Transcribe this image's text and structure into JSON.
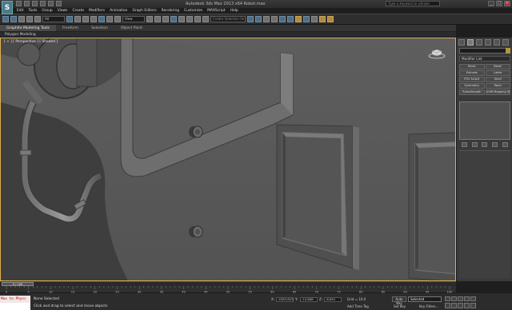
{
  "window": {
    "title": "Autodesk 3ds Max 2013 x64   Robot.max",
    "search_placeholder": "Type a keyword or phrase",
    "app_logo": "S"
  },
  "menu": [
    "Edit",
    "Tools",
    "Group",
    "Views",
    "Create",
    "Modifiers",
    "Animation",
    "Graph Editors",
    "Rendering",
    "Customize",
    "MAXScript",
    "Help"
  ],
  "toolbar": {
    "selection_filter": "All",
    "reference_coord": "View",
    "named_selection": "Create Selection Se"
  },
  "ribbon": {
    "tabs": [
      "Graphite Modeling Tools",
      "Freeform",
      "Selection",
      "Object Paint"
    ],
    "active_tab": "Graphite Modeling Tools",
    "sub_panel": "Polygon Modeling"
  },
  "viewport": {
    "label": "[ + ] [ Perspective ] [ Shaded ]"
  },
  "command_panel": {
    "modifier_list": "Modifier List",
    "buttons": [
      "Bend",
      "Bevel",
      "Extrude",
      "Lathe",
      "FFD 3x3x3",
      "Shell",
      "Symmetry",
      "Taper",
      "TurboSmooth",
      "UVW Mapping XF"
    ]
  },
  "timeline": {
    "frame": "0 / 100",
    "ticks": [
      "0",
      "5",
      "10",
      "15",
      "20",
      "25",
      "30",
      "35",
      "40",
      "45",
      "50",
      "55",
      "60",
      "65",
      "70",
      "75",
      "80",
      "85",
      "90",
      "95",
      "100"
    ]
  },
  "status": {
    "maxscript": "Max to Physc",
    "selection": "None Selected",
    "prompt": "Click and drag to select and move objects",
    "x_label": "X:",
    "x_value": "-4363.803",
    "y_label": "Y:",
    "y_value": "-14.868",
    "z_label": "Z:",
    "z_value": "-8.891",
    "grid": "Grid = 10.0",
    "auto_key": "Auto Key",
    "set_key": "Set Key",
    "selected": "Selected",
    "key_filters": "Key Filters...",
    "add_time_tag": "Add Time Tag",
    "frame_field": "0"
  }
}
